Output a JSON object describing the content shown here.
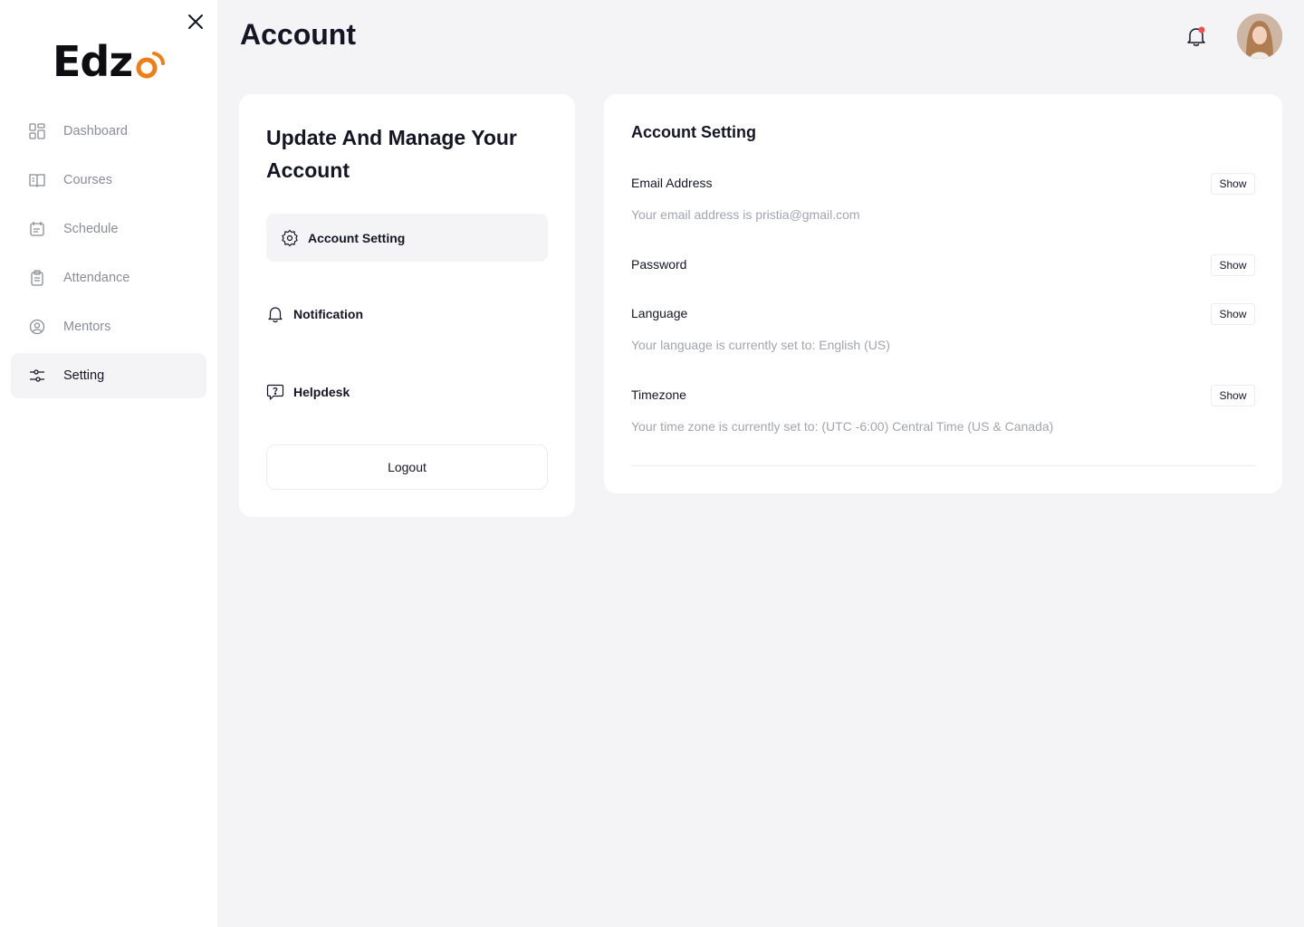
{
  "app": {
    "logo_text": "Edz",
    "brand_color": "#f07e16"
  },
  "header": {
    "title": "Account",
    "bell_icon": "bell-icon",
    "notification_dot_color": "#f24e4e"
  },
  "sidebar": {
    "items": [
      {
        "label": "Dashboard",
        "icon": "grid-icon"
      },
      {
        "label": "Courses",
        "icon": "book-icon"
      },
      {
        "label": "Schedule",
        "icon": "calendar-icon"
      },
      {
        "label": "Attendance",
        "icon": "clipboard-icon"
      },
      {
        "label": "Mentors",
        "icon": "user-badge-icon"
      },
      {
        "label": "Setting",
        "icon": "sliders-icon",
        "active": true
      }
    ]
  },
  "settings_menu": {
    "title": "Update And Manage Your Account",
    "items": [
      {
        "label": "Account Setting",
        "icon": "gear-icon",
        "active": true
      },
      {
        "label": "Notification",
        "icon": "bell-icon"
      },
      {
        "label": "Helpdesk",
        "icon": "help-chat-icon"
      }
    ],
    "logout_label": "Logout"
  },
  "account_setting": {
    "title": "Account Setting",
    "fields": [
      {
        "label": "Email Address",
        "description": "Your email address is pristia@gmail.com",
        "button": "Show"
      },
      {
        "label": "Password",
        "description": "",
        "button": "Show"
      },
      {
        "label": "Language",
        "description": "Your language is currently set to: English (US)",
        "button": "Show"
      },
      {
        "label": "Timezone",
        "description": "Your time zone is currently set to: (UTC -6:00) Central Time (US & Canada)",
        "button": "Show"
      }
    ]
  }
}
